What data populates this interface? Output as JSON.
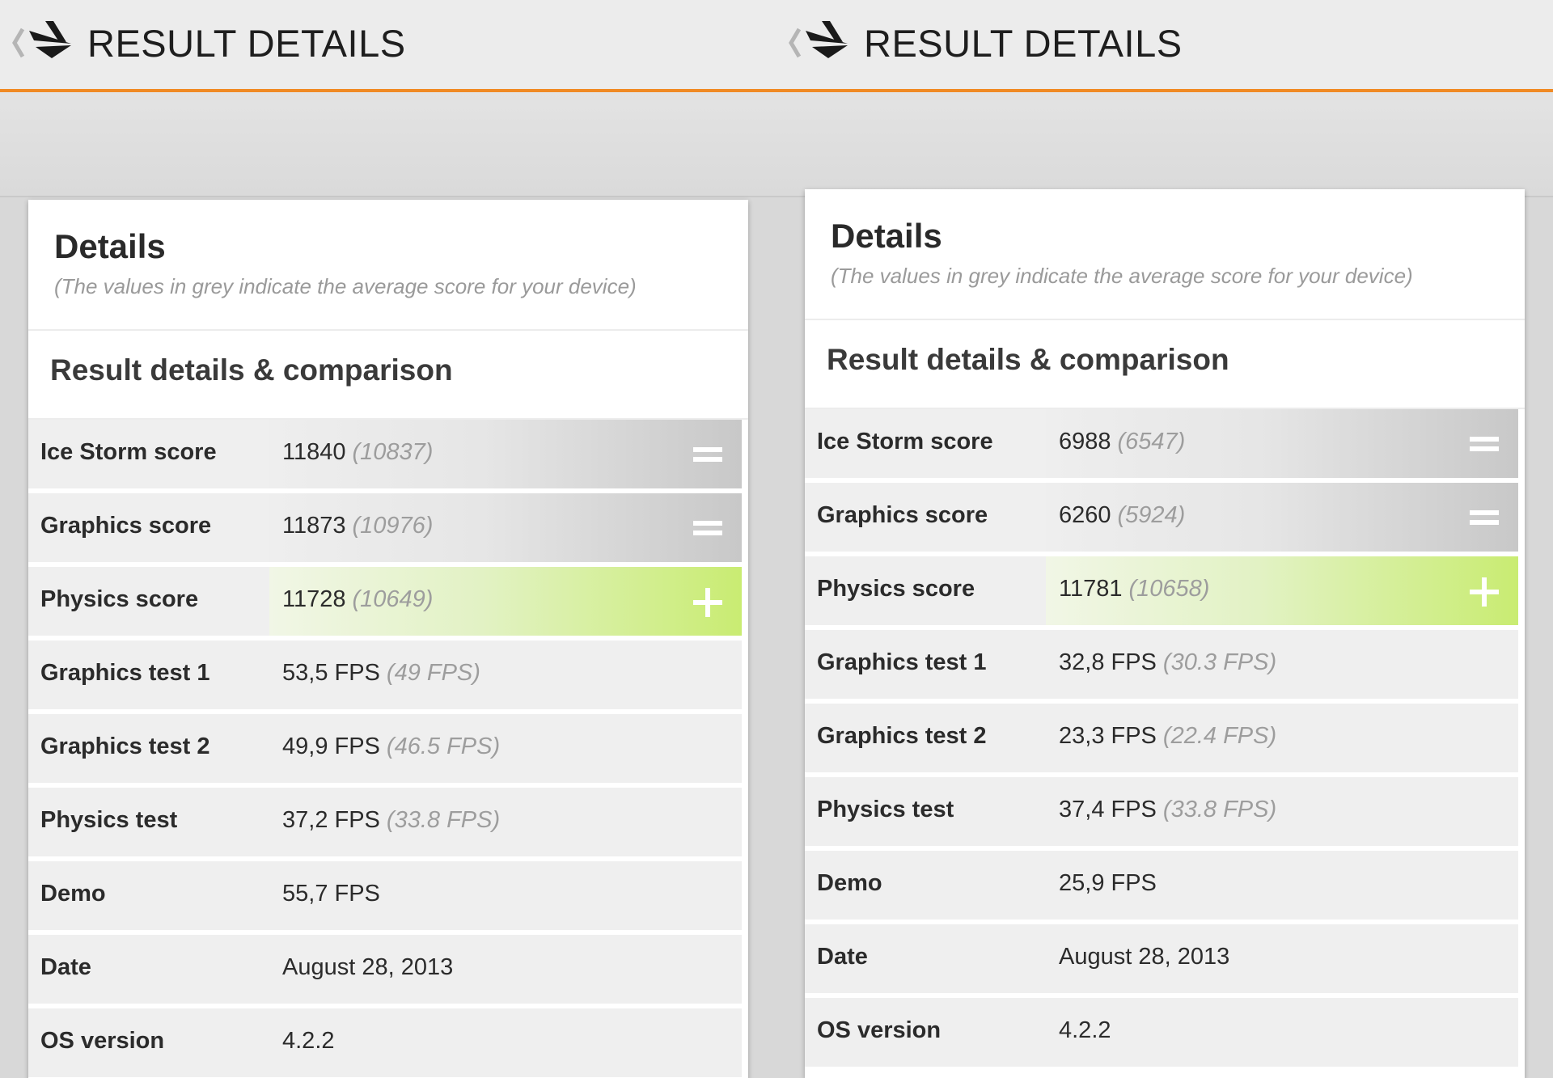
{
  "screens": [
    {
      "header_title": "RESULT DETAILS",
      "details_title": "Details",
      "details_note": "(The values in grey indicate the average score for your device)",
      "comparison_title": "Result details & comparison",
      "rows": [
        {
          "label": "Ice Storm score",
          "value": "11840",
          "average": "(10837)",
          "comparison": "equal",
          "comparison_icon": "equals-icon"
        },
        {
          "label": "Graphics score",
          "value": "11873",
          "average": "(10976)",
          "comparison": "equal",
          "comparison_icon": "equals-icon"
        },
        {
          "label": "Physics score",
          "value": "11728",
          "average": "(10649)",
          "comparison": "better",
          "comparison_icon": "plus-icon"
        },
        {
          "label": "Graphics test 1",
          "value": "53,5 FPS",
          "average": "(49 FPS)"
        },
        {
          "label": "Graphics test 2",
          "value": "49,9 FPS",
          "average": "(46.5 FPS)"
        },
        {
          "label": "Physics test",
          "value": "37,2 FPS",
          "average": "(33.8 FPS)"
        },
        {
          "label": "Demo",
          "value": "55,7 FPS",
          "average": ""
        },
        {
          "label": "Date",
          "value": "August 28, 2013",
          "average": ""
        },
        {
          "label": "OS version",
          "value": "4.2.2",
          "average": ""
        }
      ]
    },
    {
      "header_title": "RESULT DETAILS",
      "details_title": "Details",
      "details_note": "(The values in grey indicate the average score for your device)",
      "comparison_title": "Result details & comparison",
      "rows": [
        {
          "label": "Ice Storm score",
          "value": "6988",
          "average": "(6547)",
          "comparison": "equal",
          "comparison_icon": "equals-icon"
        },
        {
          "label": "Graphics score",
          "value": "6260",
          "average": "(5924)",
          "comparison": "equal",
          "comparison_icon": "equals-icon"
        },
        {
          "label": "Physics score",
          "value": "11781",
          "average": "(10658)",
          "comparison": "better",
          "comparison_icon": "plus-icon"
        },
        {
          "label": "Graphics test 1",
          "value": "32,8 FPS",
          "average": "(30.3 FPS)"
        },
        {
          "label": "Graphics test 2",
          "value": "23,3 FPS",
          "average": "(22.4 FPS)"
        },
        {
          "label": "Physics test",
          "value": "37,4 FPS",
          "average": "(33.8 FPS)"
        },
        {
          "label": "Demo",
          "value": "25,9 FPS",
          "average": ""
        },
        {
          "label": "Date",
          "value": "August 28, 2013",
          "average": ""
        },
        {
          "label": "OS version",
          "value": "4.2.2",
          "average": ""
        }
      ]
    }
  ],
  "colors": {
    "accent_orange": "#f08a24",
    "better_green": "#c9ec72",
    "average_grey": "#9d9d9d"
  }
}
